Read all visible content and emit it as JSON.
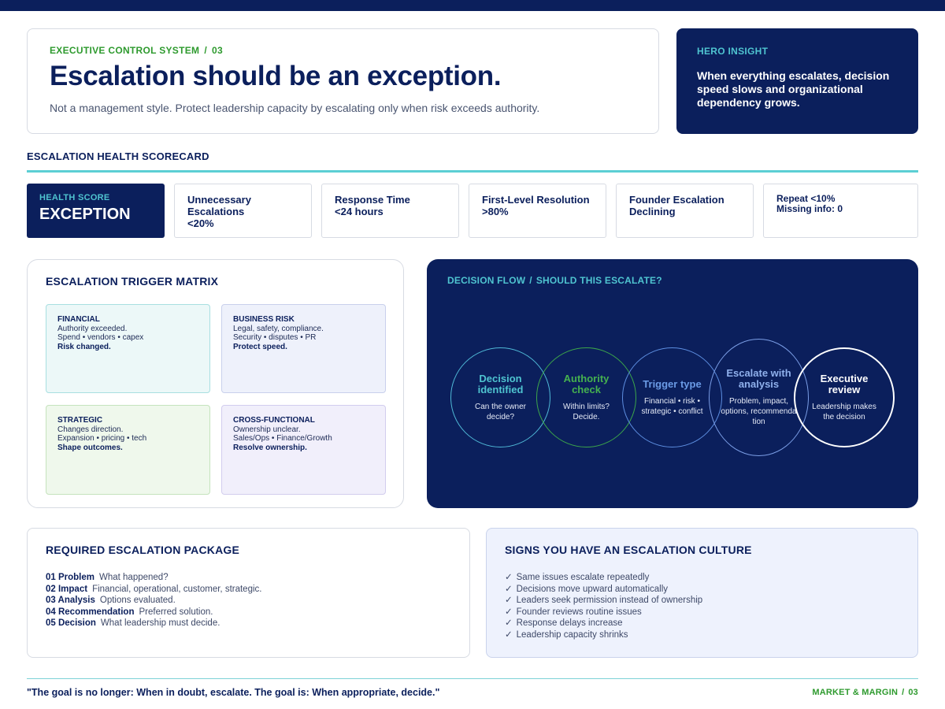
{
  "header": {
    "eyebrow_label": "EXECUTIVE CONTROL SYSTEM",
    "eyebrow_sep": "/",
    "eyebrow_number": "03",
    "headline": "Escalation should be an exception.",
    "subline": "Not a management style. Protect leadership capacity by escalating only when risk exceeds authority."
  },
  "hero": {
    "label": "HERO INSIGHT",
    "text": "When everything escalates, decision speed slows and organizational dependency grows."
  },
  "scorecard": {
    "title": "ESCALATION HEALTH SCORECARD",
    "health_label": "HEALTH SCORE",
    "health_value": "EXCEPTION",
    "boxes": [
      {
        "lines": [
          "Unnecessary",
          "Escalations",
          "<20%"
        ]
      },
      {
        "lines": [
          "Response Time",
          "<24 hours"
        ]
      },
      {
        "lines": [
          "First-Level Resolution",
          ">80%"
        ]
      },
      {
        "lines": [
          "Founder Escalation",
          "Declining"
        ]
      },
      {
        "lines": [
          "Repeat <10%",
          "Missing info: 0"
        ]
      }
    ]
  },
  "matrix": {
    "title": "ESCALATION TRIGGER MATRIX",
    "cells": [
      {
        "title": "FINANCIAL",
        "line1": "Authority exceeded.",
        "line2": "Spend • vendors • capex",
        "bold": "Risk changed."
      },
      {
        "title": "BUSINESS RISK",
        "line1": "Legal, safety, compliance.",
        "line2": "Security • disputes • PR",
        "bold": "Protect speed."
      },
      {
        "title": "STRATEGIC",
        "line1": "Changes direction.",
        "line2": "Expansion • pricing • tech",
        "bold": "Shape outcomes."
      },
      {
        "title": "CROSS-FUNCTIONAL",
        "line1": "Ownership unclear.",
        "line2": "Sales/Ops • Finance/Growth",
        "bold": "Resolve ownership."
      }
    ]
  },
  "flow": {
    "title_a": "DECISION FLOW",
    "title_sep": "/",
    "title_b": "SHOULD THIS ESCALATE?",
    "steps": [
      {
        "title": "Decision identified",
        "body": "Can the owner decide?"
      },
      {
        "title": "Authority check",
        "body": "Within limits? Decide."
      },
      {
        "title": "Trigger type",
        "body": "Financial • risk • strategic • conflict"
      },
      {
        "title": "Escalate with analysis",
        "body": "Problem, impact, options, recommenda tion"
      },
      {
        "title": "Executive review",
        "body": "Leadership makes the decision"
      }
    ]
  },
  "package": {
    "title": "REQUIRED ESCALATION PACKAGE",
    "items": [
      {
        "key": "01 Problem",
        "text": "What happened?"
      },
      {
        "key": "02 Impact",
        "text": "Financial, operational, customer, strategic."
      },
      {
        "key": "03 Analysis",
        "text": "Options evaluated."
      },
      {
        "key": "04 Recommendation",
        "text": "Preferred solution."
      },
      {
        "key": "05 Decision",
        "text": "What leadership must decide."
      }
    ]
  },
  "culture": {
    "title": "SIGNS YOU HAVE AN ESCALATION CULTURE",
    "check": "✓",
    "items": [
      "Same issues escalate repeatedly",
      "Decisions move upward automatically",
      "Leaders seek permission instead of ownership",
      "Founder reviews routine issues",
      "Response delays increase",
      "Leadership capacity shrinks"
    ]
  },
  "footer": {
    "quote": "\"The goal is no longer: When in doubt, escalate. The goal is: When appropriate, decide.\"",
    "brand": "MARKET & MARGIN",
    "brand_sep": "/",
    "brand_number": "03"
  },
  "colors": {
    "navy": "#0b1f5c",
    "green_accent": "#2e9a2e",
    "teal_accent": "#4fc4d0"
  }
}
